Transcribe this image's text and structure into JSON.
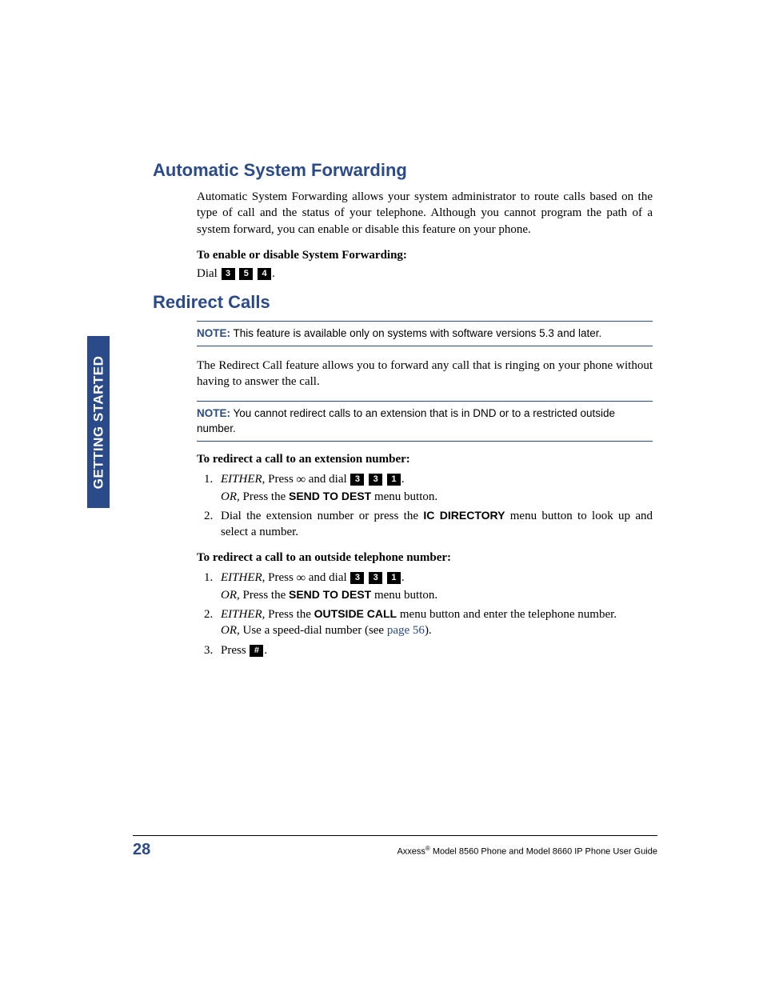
{
  "sideTab": "GETTING STARTED",
  "sections": {
    "asf": {
      "title": "Automatic System Forwarding",
      "intro": "Automatic System Forwarding allows your system administrator to route calls based on the type of call and the status of your telephone. Although you cannot program the path of a system forward, you can enable or disable this feature on your phone.",
      "enableLabel": "To enable or disable System Forwarding:",
      "dialWord": "Dial",
      "keys": [
        "3",
        "5",
        "4"
      ]
    },
    "redirect": {
      "title": "Redirect Calls",
      "note1Label": "NOTE:",
      "note1Text": " This feature is available only on systems with software versions 5.3 and later.",
      "intro": "The Redirect Call feature allows you to forward any call that is ringing on your phone without having to answer the call.",
      "note2Label": "NOTE:",
      "note2Text": " You cannot redirect calls to an extension that is in DND or to a restricted outside number.",
      "ext": {
        "heading": "To redirect a call to an extension number:",
        "step1": {
          "either": "EITHER,",
          "press": " Press ",
          "andDial": " and dial ",
          "keys": [
            "3",
            "3",
            "1"
          ],
          "or": "OR,",
          "pressThe": " Press the ",
          "btn": "SEND TO DEST",
          "menuBtn": " menu button."
        },
        "step2": {
          "pre": "Dial the extension number or press the ",
          "btn": "IC DIRECTORY",
          "post": " menu button to look up and select a number."
        }
      },
      "out": {
        "heading": "To redirect a call to an outside telephone number:",
        "step1": {
          "either": "EITHER,",
          "press": " Press ",
          "andDial": " and dial ",
          "keys": [
            "3",
            "3",
            "1"
          ],
          "or": "OR,",
          "pressThe": " Press the ",
          "btn": "SEND TO DEST",
          "menuBtn": " menu button."
        },
        "step2": {
          "either": "EITHER,",
          "pressThe": " Press the ",
          "btn": "OUTSIDE CALL",
          "post": " menu button and enter the telephone number.",
          "or": "OR",
          "speed": ", Use a speed-dial number (see ",
          "link": "page 56",
          "after": ")."
        },
        "step3": {
          "press": "Press ",
          "key": "#",
          "after": "."
        }
      }
    }
  },
  "footer": {
    "pageNum": "28",
    "brand": "Axxess",
    "suffix": " Model 8560 Phone and Model 8660 IP Phone User Guide"
  }
}
